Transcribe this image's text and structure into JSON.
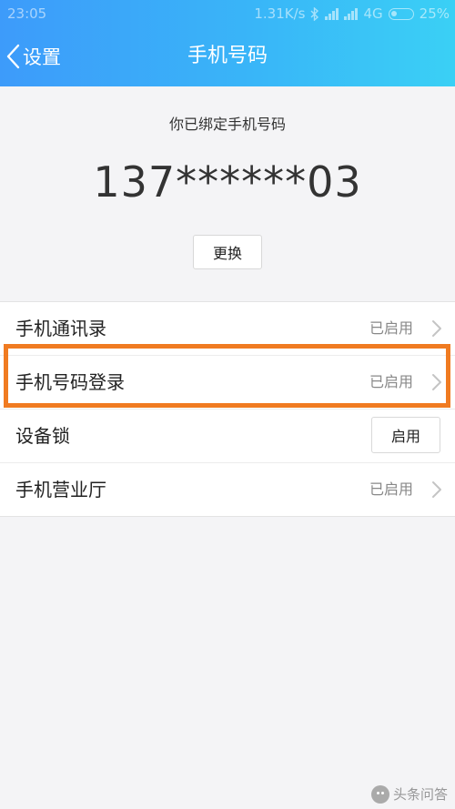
{
  "status_bar": {
    "time": "23:05",
    "network_speed": "1.31K/s",
    "network_type": "4G",
    "battery": "25%"
  },
  "header": {
    "back_label": "设置",
    "title": "手机号码"
  },
  "phone": {
    "caption": "你已绑定手机号码",
    "number": "137******03",
    "change_label": "更换"
  },
  "settings": [
    {
      "label": "手机通讯录",
      "value": "已启用"
    },
    {
      "label": "手机号码登录",
      "value": "已启用"
    },
    {
      "label": "设备锁",
      "button": "启用"
    },
    {
      "label": "手机营业厅",
      "value": "已启用"
    }
  ],
  "watermark": "头条问答",
  "colors": {
    "header_start": "#3d9bfa",
    "header_end": "#3ad0f5",
    "highlight": "#f07b21"
  }
}
